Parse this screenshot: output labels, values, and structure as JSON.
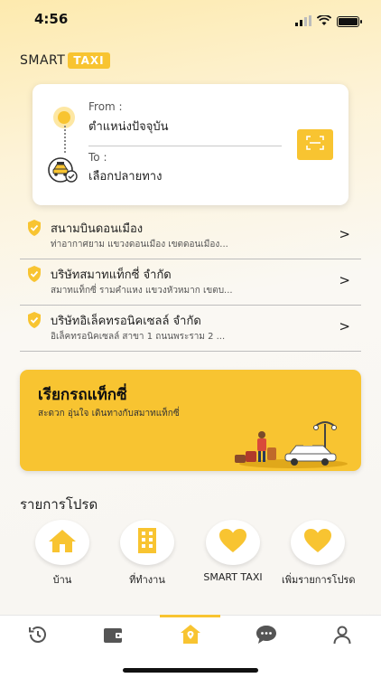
{
  "status": {
    "time": "4:56",
    "icons": [
      "signal-icon",
      "wifi-icon",
      "battery-icon"
    ]
  },
  "brand": {
    "smart": "SMART",
    "taxi": "TAXI"
  },
  "route": {
    "from_label": "From :",
    "from_value": "ตำแหน่งปัจจุบัน",
    "to_label": "To :",
    "to_value": "เลือกปลายทาง"
  },
  "places": [
    {
      "name": "สนามบินดอนเมือง",
      "address": "ท่าอากาศยาม แขวงดอนเมือง เขตดอนเมือง..."
    },
    {
      "name": "บริษัทสมาทแท็กซี่ จำกัด",
      "address": "สมาทแท็กซี่ รามคำแหง แขวงหัวหมาก เขตบ..."
    },
    {
      "name": "บริษัทอิเล็คทรอนิคเซลล์ จำกัด",
      "address": "อิเล็คทรอนิคเซลล์ สาขา 1 ถนนพระราม 2 ..."
    }
  ],
  "banner": {
    "title": "เรียกรถแท็กซี่",
    "subtitle": "สะดวก อุ่นใจ เดินทางกับสมาทแท็กซี่"
  },
  "favorites": {
    "heading": "รายการโปรด",
    "items": [
      {
        "label": "บ้าน",
        "icon": "home-icon"
      },
      {
        "label": "ที่ทำงาน",
        "icon": "building-icon"
      },
      {
        "label": "SMART TAXI",
        "icon": "heart-icon"
      },
      {
        "label": "เพิ่มรายการโปรด",
        "icon": "heart-icon"
      }
    ]
  },
  "tabs": [
    "history-icon",
    "wallet-icon",
    "home-pin-icon",
    "chat-icon",
    "profile-icon"
  ],
  "colors": {
    "accent": "#f8c431",
    "text": "#222222"
  }
}
